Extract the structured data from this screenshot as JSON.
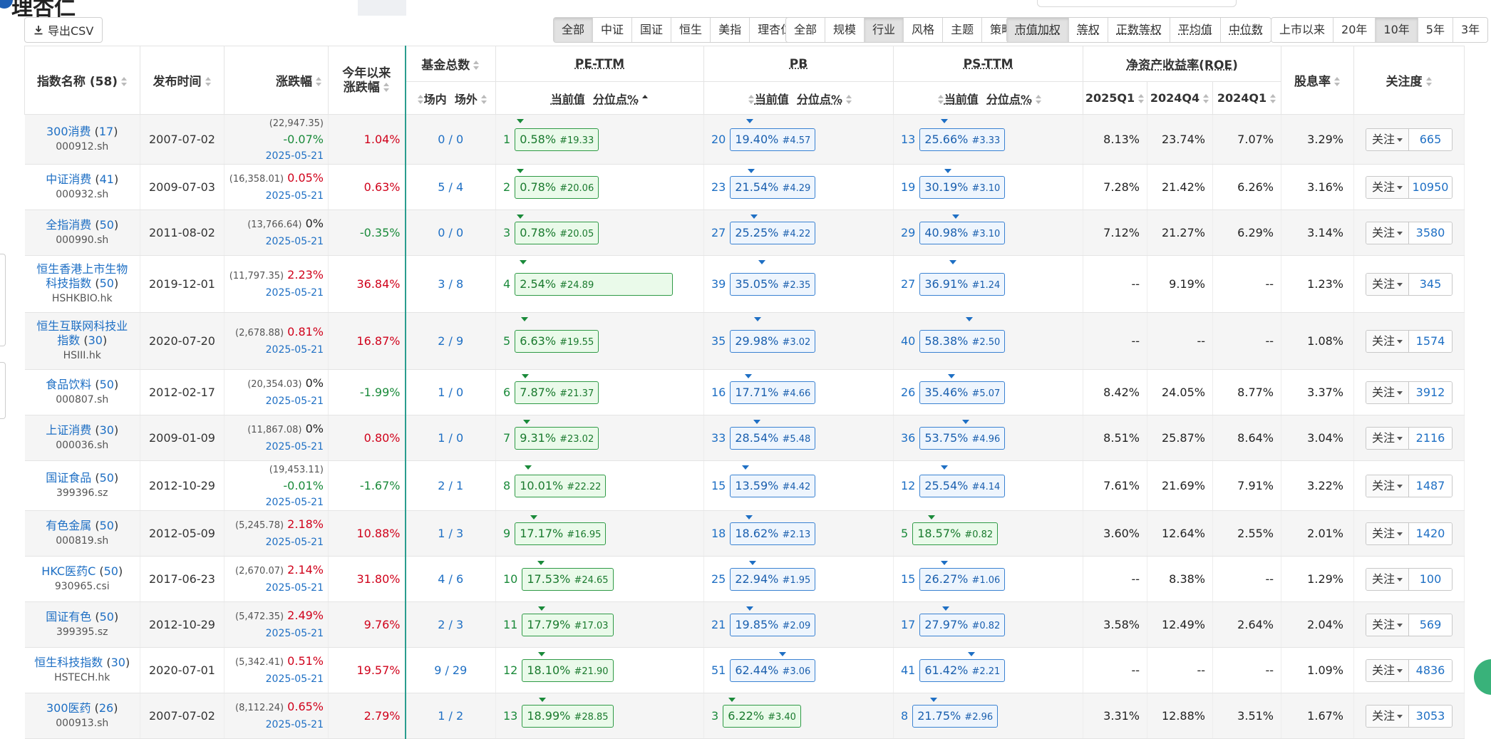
{
  "header": {
    "logo_text": "理杏仁",
    "export_label": "导出CSV"
  },
  "filters": {
    "source": [
      "全部",
      "中证",
      "国证",
      "恒生",
      "美指",
      "理杏仁"
    ],
    "category": [
      "全部",
      "规模",
      "行业",
      "风格",
      "主题",
      "策略"
    ],
    "weight": [
      "市值加权",
      "等权",
      "正数等权",
      "平均值",
      "中位数"
    ],
    "period": [
      "上市以来",
      "20年",
      "10年",
      "5年",
      "3年"
    ],
    "active": {
      "source": "全部",
      "category": "行业",
      "weight": "市值加权",
      "period": "10年"
    }
  },
  "table": {
    "headers": {
      "name": "指数名称 (58)",
      "date": "发布时间",
      "chg": "涨跌幅",
      "ytd_line1": "今年以来",
      "ytd_line2": "涨跌幅",
      "fund": "基金总数",
      "fund_in": "场内",
      "fund_out": "场外",
      "pe": "PE-TTM",
      "pb": "PB",
      "ps": "PS-TTM",
      "roe": "净资产收益率(ROE)",
      "roe_q1": "2025Q1",
      "roe_q2": "2024Q4",
      "roe_q3": "2024Q1",
      "div": "股息率",
      "follow": "关注度",
      "cur": "当前值",
      "pct": "分位点%"
    },
    "follow_label": "关注",
    "rows": [
      {
        "name": "300消费",
        "count": "17",
        "code": "000912.sh",
        "date": "2007-07-02",
        "points": "(22,947.35)",
        "chg": "-0.07%",
        "chg_color": "green",
        "chg_date": "2025-05-21",
        "ytd": "1.04%",
        "ytd_color": "red",
        "fund": "0 / 0",
        "pe_rank": "1",
        "pe_pct": "0.58%",
        "pe_val": "#19.33",
        "pe_mark": 0.58,
        "pb_rank": "20",
        "pb_pct": "19.40%",
        "pb_val": "#4.57",
        "pb_mark": 19.4,
        "ps_rank": "13",
        "ps_pct": "25.66%",
        "ps_val": "#3.33",
        "ps_mark": 25.66,
        "roe1": "8.13%",
        "roe2": "23.74%",
        "roe3": "7.07%",
        "div": "3.29%",
        "follow": "665"
      },
      {
        "name": "中证消费",
        "count": "41",
        "code": "000932.sh",
        "date": "2009-07-03",
        "points": "(16,358.01)",
        "chg": "0.05%",
        "chg_color": "red",
        "chg_date": "2025-05-21",
        "ytd": "0.63%",
        "ytd_color": "red",
        "fund": "5 / 4",
        "pe_rank": "2",
        "pe_pct": "0.78%",
        "pe_val": "#20.06",
        "pe_mark": 0.78,
        "pb_rank": "23",
        "pb_pct": "21.54%",
        "pb_val": "#4.29",
        "pb_mark": 21.54,
        "ps_rank": "19",
        "ps_pct": "30.19%",
        "ps_val": "#3.10",
        "ps_mark": 30.19,
        "roe1": "7.28%",
        "roe2": "21.42%",
        "roe3": "6.26%",
        "div": "3.16%",
        "follow": "10950"
      },
      {
        "name": "全指消费",
        "count": "50",
        "code": "000990.sh",
        "date": "2011-08-02",
        "points": "(13,766.64)",
        "chg": "0%",
        "chg_color": "black",
        "chg_date": "2025-05-21",
        "ytd": "-0.35%",
        "ytd_color": "green",
        "fund": "0 / 0",
        "pe_rank": "3",
        "pe_pct": "0.78%",
        "pe_val": "#20.05",
        "pe_mark": 0.78,
        "pb_rank": "27",
        "pb_pct": "25.25%",
        "pb_val": "#4.22",
        "pb_mark": 25.25,
        "ps_rank": "29",
        "ps_pct": "40.98%",
        "ps_val": "#3.10",
        "ps_mark": 40.98,
        "roe1": "7.12%",
        "roe2": "21.27%",
        "roe3": "6.29%",
        "div": "3.14%",
        "follow": "3580"
      },
      {
        "name": "恒生香港上市生物科技指数",
        "name2": "",
        "count": "50",
        "code": "HSHKBIO.hk",
        "date": "2019-12-01",
        "points": "(11,797.35)",
        "chg": "2.23%",
        "chg_color": "red",
        "chg_date": "2025-05-21",
        "ytd": "36.84%",
        "ytd_color": "red",
        "fund": "3 / 8",
        "pe_rank": "4",
        "pe_pct": "2.54%",
        "pe_val": "#24.89",
        "pe_mark": 2.54,
        "pb_rank": "39",
        "pb_pct": "35.05%",
        "pb_val": "#2.35",
        "pb_mark": 35.05,
        "ps_rank": "27",
        "ps_pct": "36.91%",
        "ps_val": "#1.24",
        "ps_mark": 36.91,
        "roe1": "--",
        "roe2": "9.19%",
        "roe3": "--",
        "div": "1.23%",
        "follow": "345"
      },
      {
        "name": "恒生互联网科技业指数",
        "count": "30",
        "code": "HSIII.hk",
        "date": "2020-07-20",
        "points": "(2,678.88)",
        "chg": "0.81%",
        "chg_color": "red",
        "chg_date": "2025-05-21",
        "ytd": "16.87%",
        "ytd_color": "red",
        "fund": "2 / 9",
        "pe_rank": "5",
        "pe_pct": "6.63%",
        "pe_val": "#19.55",
        "pe_mark": 6.63,
        "pb_rank": "35",
        "pb_pct": "29.98%",
        "pb_val": "#3.02",
        "pb_mark": 29.98,
        "ps_rank": "40",
        "ps_pct": "58.38%",
        "ps_val": "#2.50",
        "ps_mark": 58.38,
        "roe1": "--",
        "roe2": "--",
        "roe3": "--",
        "div": "1.08%",
        "follow": "1574"
      },
      {
        "name": "食品饮料",
        "count": "50",
        "code": "000807.sh",
        "date": "2012-02-17",
        "points": "(20,354.03)",
        "chg": "0%",
        "chg_color": "black",
        "chg_date": "2025-05-21",
        "ytd": "-1.99%",
        "ytd_color": "green",
        "fund": "1 / 0",
        "pe_rank": "6",
        "pe_pct": "7.87%",
        "pe_val": "#21.37",
        "pe_mark": 7.87,
        "pb_rank": "16",
        "pb_pct": "17.71%",
        "pb_val": "#4.66",
        "pb_mark": 17.71,
        "ps_rank": "26",
        "ps_pct": "35.46%",
        "ps_val": "#5.07",
        "ps_mark": 35.46,
        "roe1": "8.42%",
        "roe2": "24.05%",
        "roe3": "8.77%",
        "div": "3.37%",
        "follow": "3912"
      },
      {
        "name": "上证消费",
        "count": "30",
        "code": "000036.sh",
        "date": "2009-01-09",
        "points": "(11,867.08)",
        "chg": "0%",
        "chg_color": "black",
        "chg_date": "2025-05-21",
        "ytd": "0.80%",
        "ytd_color": "red",
        "fund": "1 / 0",
        "pe_rank": "7",
        "pe_pct": "9.31%",
        "pe_val": "#23.02",
        "pe_mark": 9.31,
        "pb_rank": "33",
        "pb_pct": "28.54%",
        "pb_val": "#5.48",
        "pb_mark": 28.54,
        "ps_rank": "36",
        "ps_pct": "53.75%",
        "ps_val": "#4.96",
        "ps_mark": 53.75,
        "roe1": "8.51%",
        "roe2": "25.87%",
        "roe3": "8.64%",
        "div": "3.04%",
        "follow": "2116"
      },
      {
        "name": "国证食品",
        "count": "50",
        "code": "399396.sz",
        "date": "2012-10-29",
        "points": "(19,453.11)",
        "chg": "-0.01%",
        "chg_color": "green",
        "chg_date": "2025-05-21",
        "ytd": "-1.67%",
        "ytd_color": "green",
        "fund": "2 / 1",
        "pe_rank": "8",
        "pe_pct": "10.01%",
        "pe_val": "#22.22",
        "pe_mark": 10.01,
        "pb_rank": "15",
        "pb_pct": "13.59%",
        "pb_val": "#4.42",
        "pb_mark": 13.59,
        "ps_rank": "12",
        "ps_pct": "25.54%",
        "ps_val": "#4.14",
        "ps_mark": 25.54,
        "roe1": "7.61%",
        "roe2": "21.69%",
        "roe3": "7.91%",
        "div": "3.22%",
        "follow": "1487"
      },
      {
        "name": "有色金属",
        "count": "50",
        "code": "000819.sh",
        "date": "2012-05-09",
        "points": "(5,245.78)",
        "chg": "2.18%",
        "chg_color": "red",
        "chg_date": "2025-05-21",
        "ytd": "10.88%",
        "ytd_color": "red",
        "fund": "1 / 3",
        "pe_rank": "9",
        "pe_pct": "17.17%",
        "pe_val": "#16.95",
        "pe_mark": 17.17,
        "pb_rank": "18",
        "pb_pct": "18.62%",
        "pb_val": "#2.13",
        "pb_mark": 18.62,
        "ps_rank": "5",
        "ps_pct": "18.57%",
        "ps_val": "#0.82",
        "ps_mark": 18.57,
        "ps_color": "g",
        "roe1": "3.60%",
        "roe2": "12.64%",
        "roe3": "2.55%",
        "div": "2.01%",
        "follow": "1420"
      },
      {
        "name": "HKC医药C",
        "count": "50",
        "code": "930965.csi",
        "date": "2017-06-23",
        "points": "(2,670.07)",
        "chg": "2.14%",
        "chg_color": "red",
        "chg_date": "2025-05-21",
        "ytd": "31.80%",
        "ytd_color": "red",
        "fund": "4 / 6",
        "pe_rank": "10",
        "pe_pct": "17.53%",
        "pe_val": "#24.65",
        "pe_mark": 17.53,
        "pb_rank": "25",
        "pb_pct": "22.94%",
        "pb_val": "#1.95",
        "pb_mark": 22.94,
        "ps_rank": "15",
        "ps_pct": "26.27%",
        "ps_val": "#1.06",
        "ps_mark": 26.27,
        "roe1": "--",
        "roe2": "8.38%",
        "roe3": "--",
        "div": "1.29%",
        "follow": "100"
      },
      {
        "name": "国证有色",
        "count": "50",
        "code": "399395.sz",
        "date": "2012-10-29",
        "points": "(5,472.35)",
        "chg": "2.49%",
        "chg_color": "red",
        "chg_date": "2025-05-21",
        "ytd": "9.76%",
        "ytd_color": "red",
        "fund": "2 / 3",
        "pe_rank": "11",
        "pe_pct": "17.79%",
        "pe_val": "#17.03",
        "pe_mark": 17.79,
        "pb_rank": "21",
        "pb_pct": "19.85%",
        "pb_val": "#2.09",
        "pb_mark": 19.85,
        "ps_rank": "17",
        "ps_pct": "27.97%",
        "ps_val": "#0.82",
        "ps_mark": 27.97,
        "roe1": "3.58%",
        "roe2": "12.49%",
        "roe3": "2.64%",
        "div": "2.04%",
        "follow": "569"
      },
      {
        "name": "恒生科技指数",
        "count": "30",
        "code": "HSTECH.hk",
        "date": "2020-07-01",
        "points": "(5,342.41)",
        "chg": "0.51%",
        "chg_color": "red",
        "chg_date": "2025-05-21",
        "ytd": "19.57%",
        "ytd_color": "red",
        "fund": "9 / 29",
        "pe_rank": "12",
        "pe_pct": "18.10%",
        "pe_val": "#21.90",
        "pe_mark": 18.1,
        "pb_rank": "51",
        "pb_pct": "62.44%",
        "pb_val": "#3.06",
        "pb_mark": 62.44,
        "ps_rank": "41",
        "ps_pct": "61.42%",
        "ps_val": "#2.21",
        "ps_mark": 61.42,
        "roe1": "--",
        "roe2": "--",
        "roe3": "--",
        "div": "1.09%",
        "follow": "4836"
      },
      {
        "name": "300医药",
        "count": "26",
        "code": "000913.sh",
        "date": "2007-07-02",
        "points": "(8,112.24)",
        "chg": "0.65%",
        "chg_color": "red",
        "chg_date": "2025-05-21",
        "ytd": "2.79%",
        "ytd_color": "red",
        "fund": "1 / 2",
        "pe_rank": "13",
        "pe_pct": "18.99%",
        "pe_val": "#28.85",
        "pe_mark": 18.99,
        "pb_rank": "3",
        "pb_pct": "6.22%",
        "pb_val": "#3.40",
        "pb_mark": 6.22,
        "pb_color": "g",
        "ps_rank": "8",
        "ps_pct": "21.75%",
        "ps_val": "#2.96",
        "ps_mark": 21.75,
        "roe1": "3.31%",
        "roe2": "12.88%",
        "roe3": "3.51%",
        "div": "1.67%",
        "follow": "3053"
      }
    ]
  }
}
